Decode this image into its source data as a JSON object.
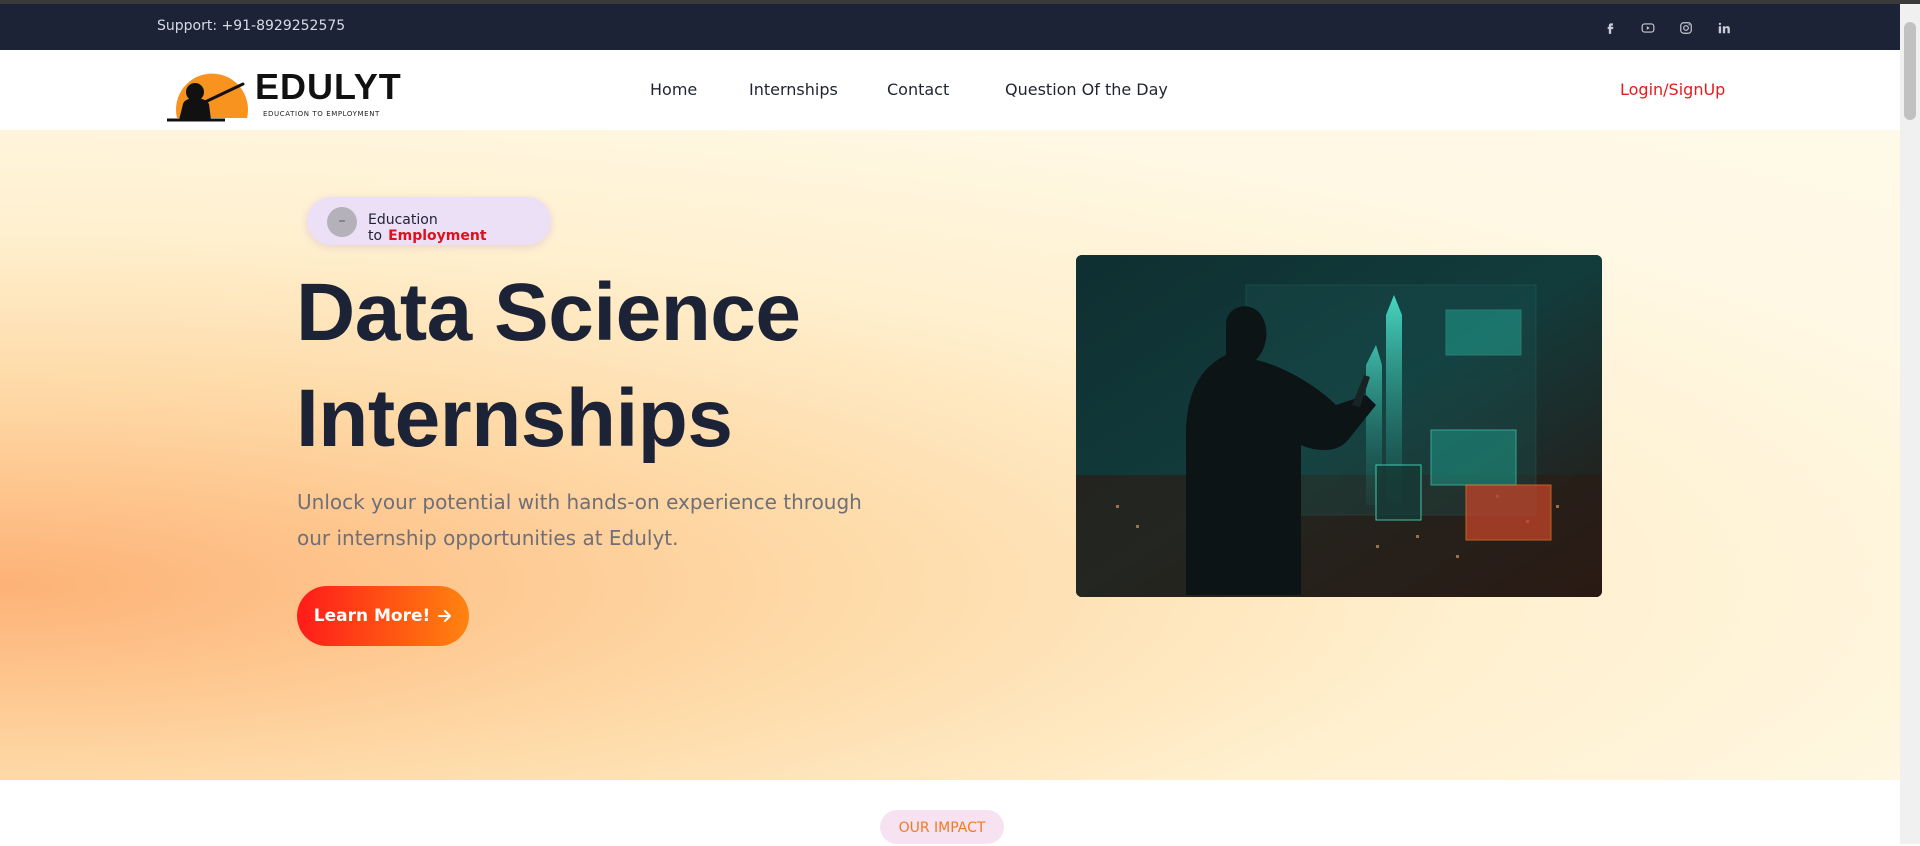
{
  "topbar": {
    "support": "Support: +91-8929252575",
    "social": [
      "facebook-icon",
      "youtube-icon",
      "instagram-icon",
      "linkedin-icon"
    ]
  },
  "brand": {
    "name": "EDULYT",
    "tagline": "EDUCATION TO EMPLOYMENT"
  },
  "nav": {
    "items": [
      {
        "label": "Home"
      },
      {
        "label": "Internships"
      },
      {
        "label": "Contact"
      },
      {
        "label": "Question Of the Day"
      }
    ],
    "login": "Login/SignUp"
  },
  "hero": {
    "badge_prefix": "Education to",
    "badge_emphasis": "Employment",
    "title_line1": "Data Science",
    "title_line2": "Internships",
    "description": "Unlock your potential with hands-on experience through our internship opportunities at Edulyt.",
    "cta": "Learn More!"
  },
  "impact": {
    "label": "OUR IMPACT"
  },
  "colors": {
    "topbar": "#1c2336",
    "accent_red": "#e0101a",
    "accent_orange": "#ff8410",
    "title": "#1c2336"
  }
}
